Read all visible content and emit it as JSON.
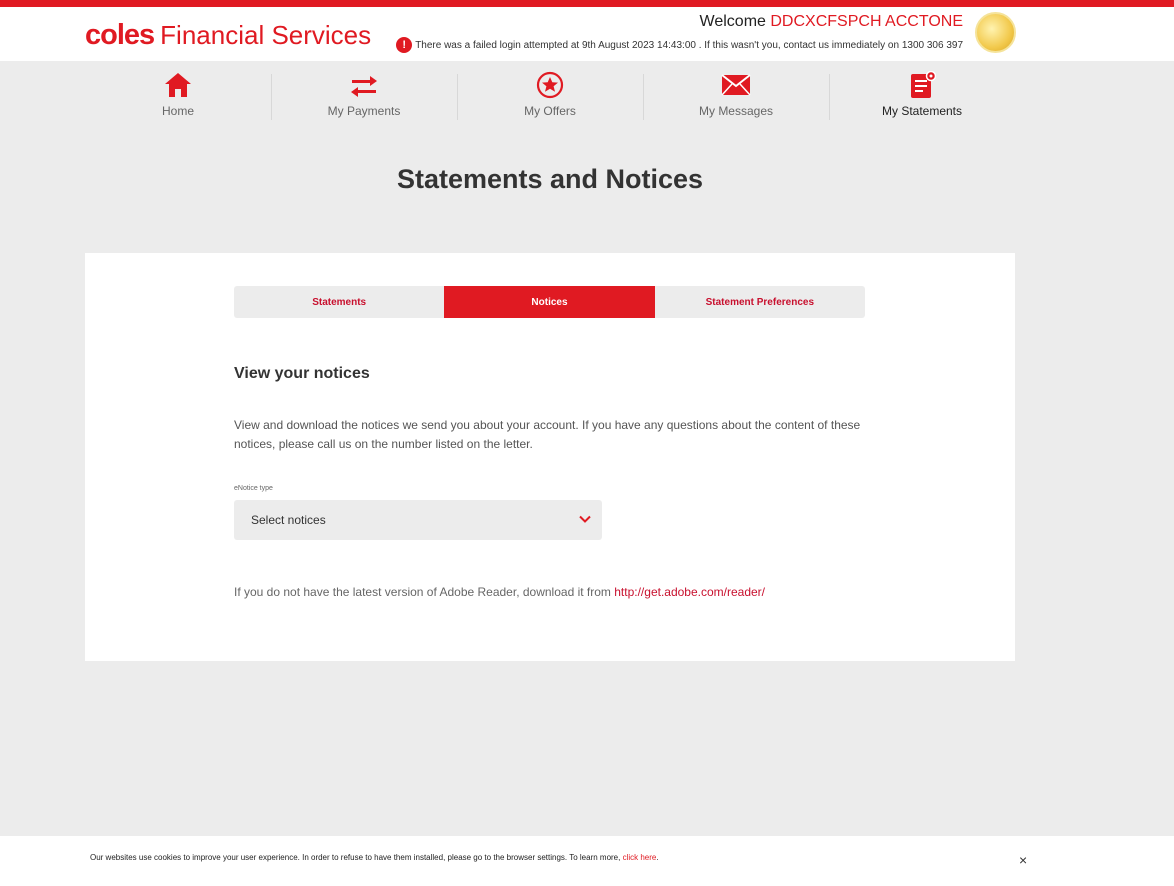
{
  "header": {
    "brand": "coles",
    "service": "Financial Services",
    "welcome_label": "Welcome",
    "username": "DDCXCFSPCH ACCTONE",
    "alert_text": "There was a failed login attempted at 9th August 2023 14:43:00 . If this wasn't you, contact us immediately on 1300 306 397",
    "alert_icon": "exclamation-icon"
  },
  "nav": {
    "items": [
      {
        "label": "Home",
        "icon": "home-icon"
      },
      {
        "label": "My Payments",
        "icon": "transfer-arrows-icon"
      },
      {
        "label": "My Offers",
        "icon": "star-icon"
      },
      {
        "label": "My Messages",
        "icon": "envelope-icon"
      },
      {
        "label": "My Statements",
        "icon": "statement-icon"
      }
    ],
    "active": "My Statements"
  },
  "main": {
    "title": "Statements and Notices",
    "tabs": [
      {
        "label": "Statements"
      },
      {
        "label": "Notices"
      },
      {
        "label": "Statement Preferences"
      }
    ],
    "active_tab": "Notices",
    "section_title": "View your notices",
    "description": "View and download the notices we send you about your account. If you have any questions about the content of these notices, please call us on the number listed on the letter.",
    "enotice": {
      "label": "eNotice type",
      "placeholder": "Select notices"
    },
    "adobe_text": "If you do not have the latest version of Adobe Reader, download it from ",
    "adobe_link": "http://get.adobe.com/reader/"
  },
  "cookie": {
    "text": "Our websites use cookies to improve your user experience. In order to refuse to have them installed, please go to the browser settings. To learn more, ",
    "link": "click here",
    "end": ".",
    "close": "×"
  },
  "colors": {
    "accent": "#e01a22",
    "background": "#ececec"
  }
}
